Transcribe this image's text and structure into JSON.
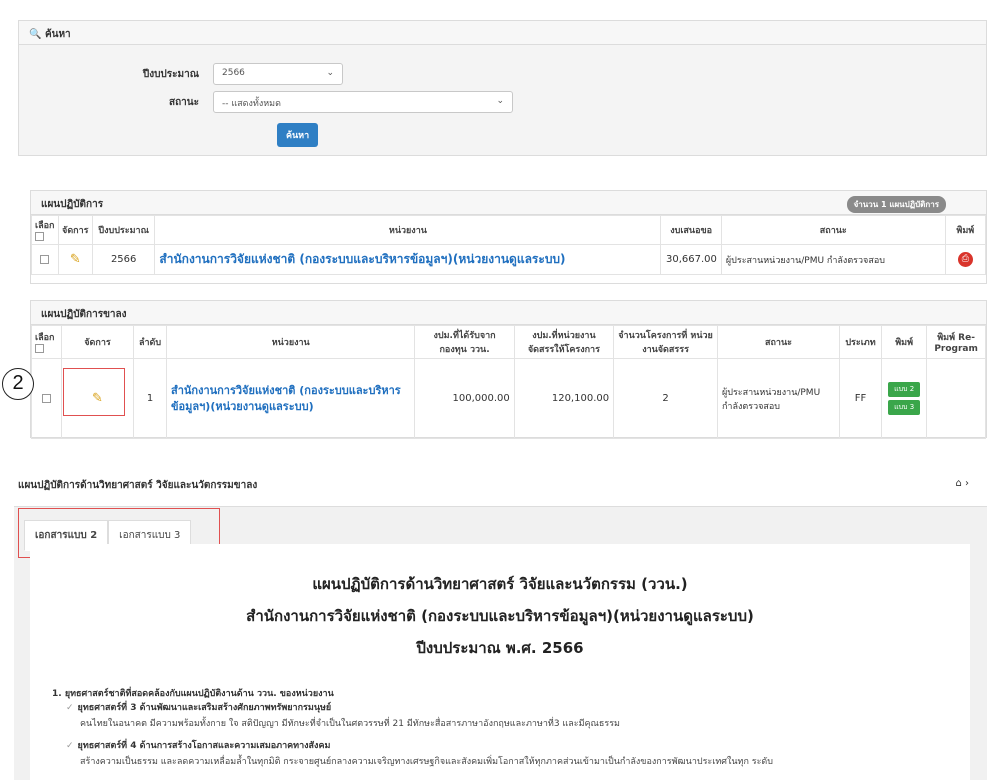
{
  "search": {
    "title": "ค้นหา",
    "year_label": "ปีงบประมาณ",
    "year_value": "2566",
    "status_label": "สถานะ",
    "status_value": "-- แสดงทั้งหมด",
    "search_button": "ค้นหา"
  },
  "plan": {
    "title": "แผนปฏิบัติการ",
    "count_badge": "จำนวน 1 แผนปฏิบัติการ",
    "headers": [
      "เลือก",
      "จัดการ",
      "ปีงบประมาณ",
      "หน่วยงาน",
      "งบเสนอขอ",
      "สถานะ",
      "พิมพ์"
    ],
    "row": {
      "year": "2566",
      "agency": "สำนักงานการวิจัยแห่งชาติ (กองระบบและบริหารข้อมูลฯ)(หน่วยงานดูแลระบบ)",
      "budget": "30,667.00",
      "status": "ผู้ประสานหน่วยงาน/PMU กำลังตรวจสอบ"
    }
  },
  "subplan": {
    "title": "แผนปฏิบัติการขาลง",
    "headers": [
      "เลือก",
      "จัดการ",
      "ลำดับ",
      "หน่วยงาน",
      "งปม.ที่ได้รับจาก กองทุน ววน.",
      "งปม.ที่หน่วยงาน จัดสรรให้โครงการ",
      "จำนวนโครงการที่ หน่วยงานจัดสรรร",
      "สถานะ",
      "ประเภท",
      "พิมพ์",
      "พิมพ์ Re-Program"
    ],
    "row": {
      "order": "1",
      "agency": "สำนักงานการวิจัยแห่งชาติ (กองระบบและบริหารข้อมูลฯ)(หน่วยงานดูแลระบบ)",
      "received": "100,000.00",
      "allocated": "120,100.00",
      "projects": "2",
      "status": "ผู้ประสานหน่วยงาน/PMU กำลังตรวจสอบ",
      "type": "FF",
      "print1": "แบบ 2",
      "print2": "แบบ 3"
    }
  },
  "step_number": "2",
  "bottom": {
    "page_title": "แผนปฏิบัติการด้านวิทยาศาสตร์ วิจัยและนวัตกรรมขาลง",
    "home_icon": "⌂ ›",
    "tabs": [
      "เอกสารแบบ 2",
      "เอกสารแบบ 3"
    ],
    "doc": {
      "heading1": "แผนปฏิบัติการด้านวิทยาศาสตร์ วิจัยและนวัตกรรม (ววน.)",
      "heading2": "สำนักงานการวิจัยแห่งชาติ (กองระบบและบริหารข้อมูลฯ)(หน่วยงานดูแลระบบ)",
      "heading3": "ปีงบประมาณ พ.ศ. 2566",
      "section1": "1. ยุทธศาสตร์ชาติที่สอดคล้องกับแผนปฏิบัติงานด้าน ววน. ของหน่วยงาน",
      "item1_title": "ยุทธศาสตร์ที่ 3 ด้านพัฒนาและเสริมสร้างศักยภาพทรัพยากรมนุษย์",
      "item1_desc": "คนไทยในอนาคต มีความพร้อมทั้งกาย ใจ สติปัญญา มีทักษะที่จำเป็นในศตวรรษที่ 21 มีทักษะสื่อสารภาษาอังกฤษและภาษาที่3 และมีคุณธรรม",
      "item2_title": "ยุทธศาสตร์ที่ 4 ด้านการสร้างโอกาสและความเสมอภาคทางสังคม",
      "item2_desc": "สร้างความเป็นธรรม และลดความเหลื่อมล้ำในทุกมิติ กระจายศูนย์กลางความเจริญทางเศรษฐกิจและสังคมเพิ่มโอกาสให้ทุกภาคส่วนเข้ามาเป็นกำลังของการพัฒนาประเทศในทุก ระดับ"
    }
  }
}
